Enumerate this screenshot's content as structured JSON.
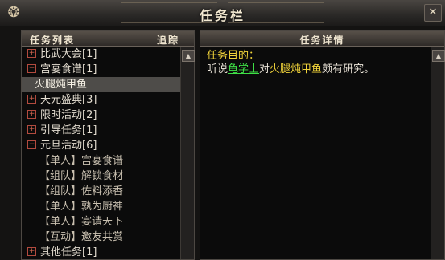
{
  "window": {
    "title": "任务栏",
    "close_glyph": "✕",
    "corner_glyph": "❂"
  },
  "task_list": {
    "header": "任务列表",
    "track_label": "追踪",
    "items": [
      {
        "label": "比武大会[1]",
        "type": "group",
        "expander": "+"
      },
      {
        "label": "宫宴食谱[1]",
        "type": "group",
        "expander": "−"
      },
      {
        "label": "火腿炖甲鱼",
        "type": "task",
        "selected": true
      },
      {
        "label": "天元盛典[3]",
        "type": "group",
        "expander": "+"
      },
      {
        "label": "限时活动[2]",
        "type": "group",
        "expander": "+"
      },
      {
        "label": "引导任务[1]",
        "type": "group",
        "expander": "+"
      },
      {
        "label": "元旦活动[6]",
        "type": "group",
        "expander": "−"
      },
      {
        "label": "【单人】宫宴食谱",
        "type": "task"
      },
      {
        "label": "【组队】解锁食材",
        "type": "task"
      },
      {
        "label": "【组队】佐料添香",
        "type": "task"
      },
      {
        "label": "【单人】孰为厨神",
        "type": "task"
      },
      {
        "label": "【单人】宴请天下",
        "type": "task"
      },
      {
        "label": "【互动】邀友共赏",
        "type": "task"
      },
      {
        "label": "其他任务[1]",
        "type": "group",
        "expander": "+"
      }
    ]
  },
  "task_details": {
    "header": "任务详情",
    "objective_title": "任务目的：",
    "line_prefix": "听说",
    "npc_name": "龟学士",
    "line_mid": "对",
    "dish_name": "火腿炖甲鱼",
    "line_suffix": "颇有研究。"
  },
  "scroll": {
    "up_glyph": "▲"
  }
}
